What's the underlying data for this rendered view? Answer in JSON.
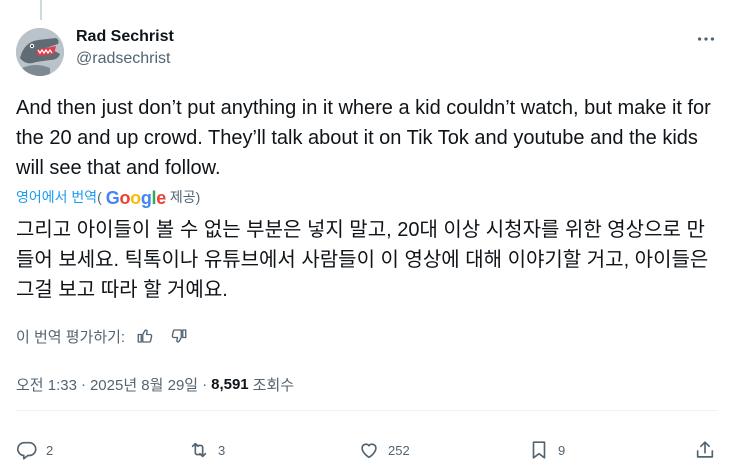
{
  "author": {
    "display_name": "Rad Sechrist",
    "handle": "@radsechrist",
    "avatar_icon": "crocodile-avatar"
  },
  "more_icon": "more-horizontal-icon",
  "tweet": {
    "text": "And then just don’t put anything in it where a kid couldn’t watch, but make it for the 20 and up crowd. They’ll talk about it on Tik Tok and youtube and the kids will see that and follow."
  },
  "translation": {
    "link_label": "영어에서 번역",
    "open_paren": "(",
    "provider": "Google",
    "provided_label": "제공)",
    "text": "그리고 아이들이 볼 수 없는 부분은 넣지 말고, 20대 이상 시청자를 위한 영상으로 만들어 보세요. 틱톡이나 유튜브에서 사람들이 이 영상에 대해 이야기할 거고, 아이들은 그걸 보고 따라 할 거예요.",
    "rate_label": "이 번역 평가하기:",
    "rate_up_icon": "thumbs-up-icon",
    "rate_down_icon": "thumbs-down-icon"
  },
  "meta": {
    "time": "오전 1:33",
    "separator": "·",
    "date": "2025년 8월 29일",
    "views_count": "8,591",
    "views_label": "조회수"
  },
  "actions": {
    "reply_count": "2",
    "retweet_count": "3",
    "like_count": "252",
    "bookmark_count": "9"
  },
  "colors": {
    "accent": "#1d9bf0",
    "text_primary": "#0f1419",
    "text_secondary": "#536471",
    "google_blue": "#4285F4",
    "google_red": "#EA4335",
    "google_yellow": "#FBBC05",
    "google_green": "#34A853"
  }
}
